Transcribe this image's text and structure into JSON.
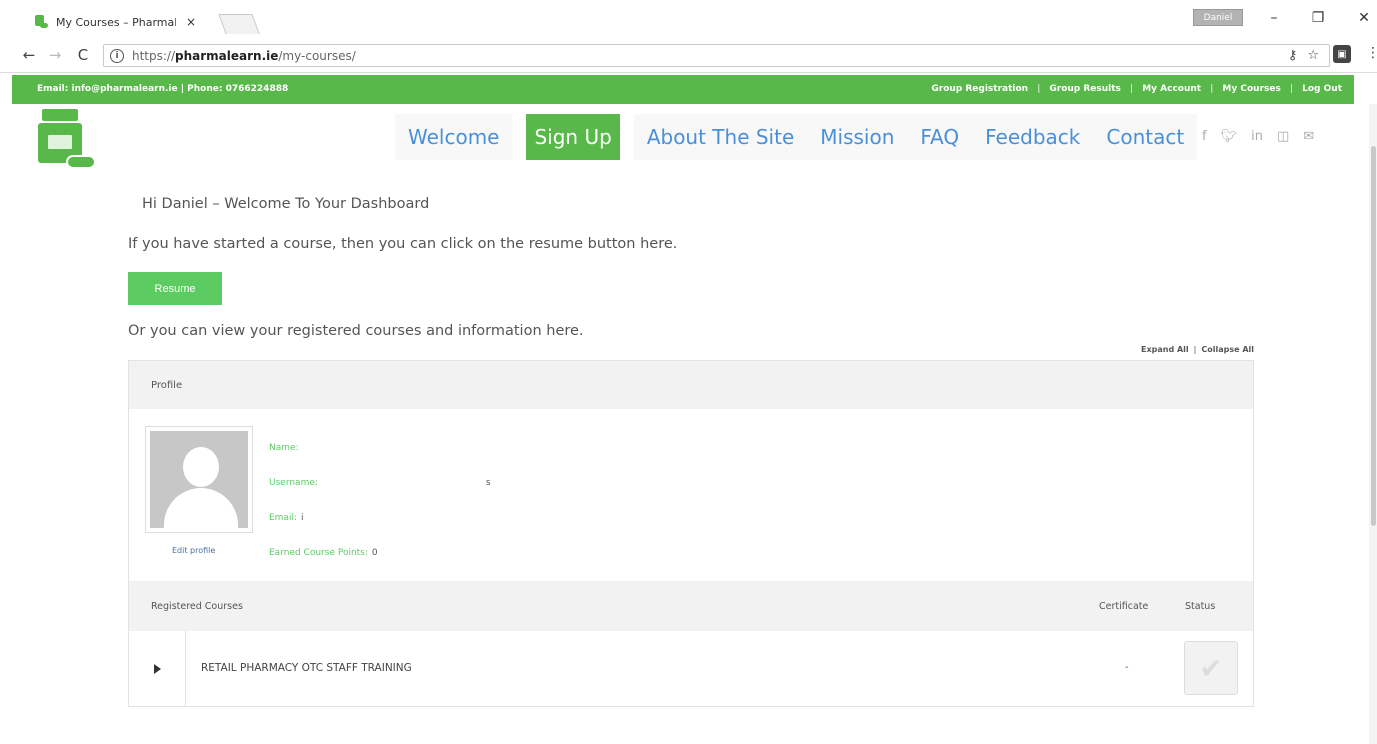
{
  "browser": {
    "tab_title": "My Courses – PharmaLe:",
    "tab_close": "×",
    "profile_badge": "Daniel",
    "url_host": "https://pharmalearn.ie",
    "url_path": "/my-courses/",
    "url_prefix": "https://",
    "url_domain": "pharmalearn.ie",
    "url_rest": "/my-courses/"
  },
  "topbar": {
    "contact": "Email: info@pharmalearn.ie | Phone: 0766224888",
    "links": [
      "Group Registration",
      "Group Results",
      "My Account",
      "My Courses",
      "Log Out"
    ]
  },
  "menu": {
    "items": [
      "Welcome",
      "Sign Up",
      "About The Site",
      "Mission",
      "FAQ",
      "Feedback",
      "Contact"
    ],
    "active": "Sign Up"
  },
  "social_icons": [
    "facebook-icon",
    "twitter-icon",
    "linkedin-icon",
    "instagram-icon",
    "email-icon"
  ],
  "dashboard": {
    "greeting": "Hi Daniel – Welcome To Your Dashboard",
    "intro": "If you have started a course, then you can click on the resume button here.",
    "resume_label": "Resume",
    "view_text": "Or you can view your registered courses and information here.",
    "expand_all": "Expand All",
    "collapse_all": "Collapse All"
  },
  "profile": {
    "heading": "Profile",
    "edit_label": "Edit profile",
    "name_label": "Name:",
    "name_value": "",
    "username_label": "Username:",
    "username_value": "s",
    "email_label": "Email:",
    "email_value": "i",
    "points_label": "Earned Course Points:",
    "points_value": "0"
  },
  "courses": {
    "col_registered": "Registered Courses",
    "col_certificate": "Certificate",
    "col_status": "Status",
    "rows": [
      {
        "name": "RETAIL PHARMACY OTC STAFF TRAINING",
        "certificate": "-"
      }
    ]
  },
  "colors": {
    "brand_green": "#59b84a",
    "button_green": "#5ccc62",
    "menu_blue": "#4a90d9"
  }
}
